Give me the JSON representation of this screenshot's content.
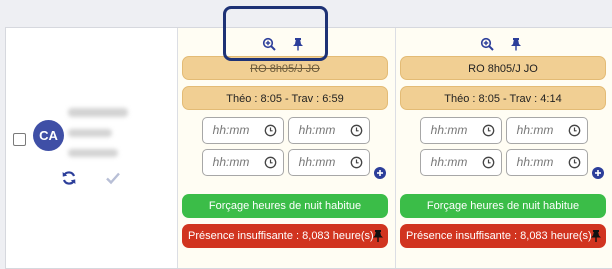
{
  "employee": {
    "initials": "CA",
    "avatar_color": "#3f4fa6"
  },
  "days": [
    {
      "shift_code": "RO 8h05/J JO",
      "shift_struck": true,
      "theo_trav": "Théo : 8:05 - Trav : 6:59",
      "time_placeholder": "hh:mm",
      "forcing_label": "Forçage heures de nuit habitue",
      "presence_label": "Présence insuffisante : 8,083 heure(s)"
    },
    {
      "shift_code": "RO 8h05/J JO",
      "shift_struck": false,
      "theo_trav": "Théo : 8:05 - Trav : 4:14",
      "time_placeholder": "hh:mm",
      "forcing_label": "Forçage heures de nuit habitue",
      "presence_label": "Présence insuffisante : 8,083 heure(s)"
    }
  ],
  "colors": {
    "tan": "#f1cf93",
    "green": "#3bbd48",
    "red": "#d1341f",
    "highlight": "#1e3275",
    "icon_blue": "#2c3e9a"
  }
}
